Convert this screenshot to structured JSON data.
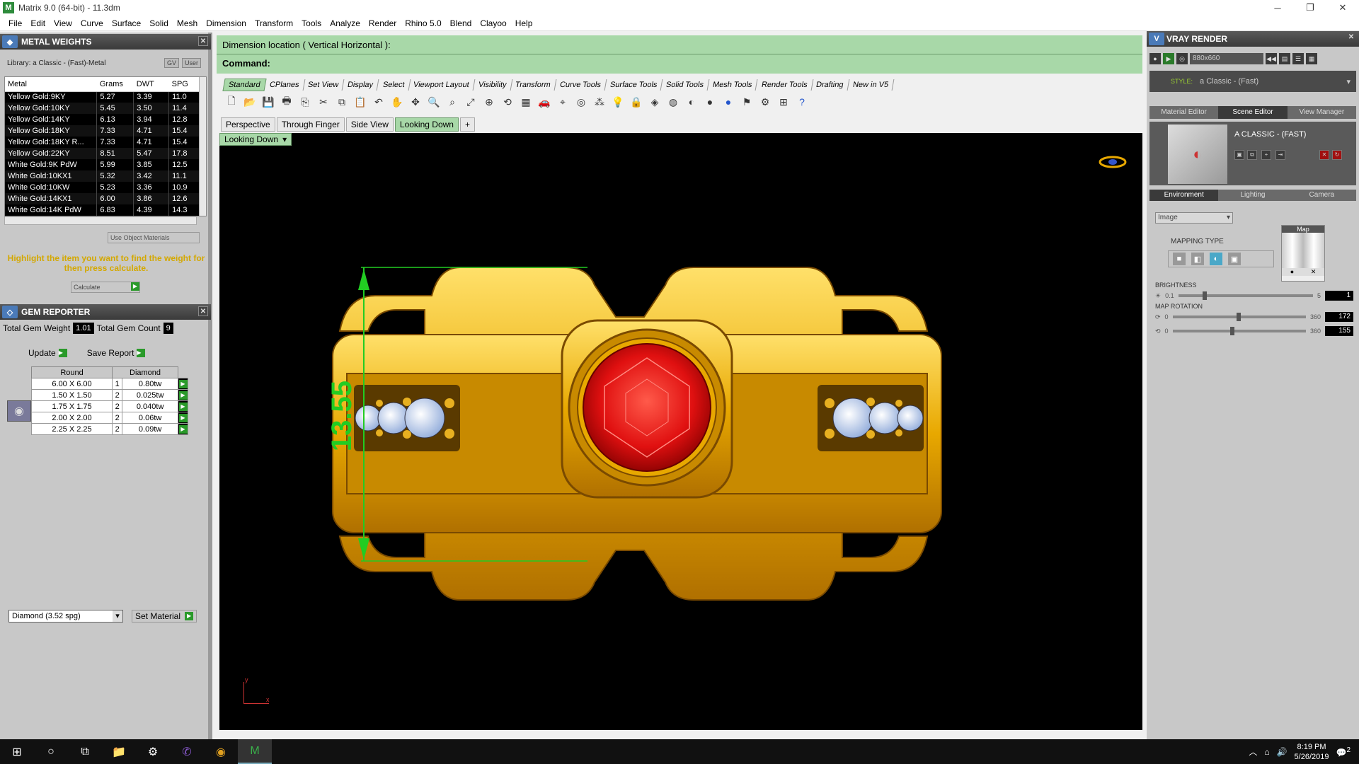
{
  "window": {
    "title": "Matrix 9.0 (64-bit) - 11.3dm",
    "logo": "M"
  },
  "menu": [
    "File",
    "Edit",
    "View",
    "Curve",
    "Surface",
    "Solid",
    "Mesh",
    "Dimension",
    "Transform",
    "Tools",
    "Analyze",
    "Render",
    "Rhino 5.0",
    "Blend",
    "Clayoo",
    "Help"
  ],
  "metal_weights": {
    "title": "METAL WEIGHTS",
    "library": "Library: a Classic - (Fast)-Metal",
    "lib_btns": [
      "GV",
      "User"
    ],
    "columns": [
      "Metal",
      "Grams",
      "DWT",
      "SPG"
    ],
    "rows": [
      [
        "Yellow Gold:9KY",
        "5.27",
        "3.39",
        "11.0"
      ],
      [
        "Yellow Gold:10KY",
        "5.45",
        "3.50",
        "11.4"
      ],
      [
        "Yellow Gold:14KY",
        "6.13",
        "3.94",
        "12.8"
      ],
      [
        "Yellow Gold:18KY",
        "7.33",
        "4.71",
        "15.4"
      ],
      [
        "Yellow Gold:18KY R...",
        "7.33",
        "4.71",
        "15.4"
      ],
      [
        "Yellow Gold:22KY",
        "8.51",
        "5.47",
        "17.8"
      ],
      [
        "White Gold:9K PdW",
        "5.99",
        "3.85",
        "12.5"
      ],
      [
        "White Gold:10KX1",
        "5.32",
        "3.42",
        "11.1"
      ],
      [
        "White Gold:10KW",
        "5.23",
        "3.36",
        "10.9"
      ],
      [
        "White Gold:14KX1",
        "6.00",
        "3.86",
        "12.6"
      ],
      [
        "White Gold:14K PdW",
        "6.83",
        "4.39",
        "14.3"
      ]
    ],
    "use_object": "Use Object Materials",
    "hint": "Highlight the item you want to find the weight for then press calculate.",
    "calculate": "Calculate"
  },
  "gem_reporter": {
    "title": "GEM REPORTER",
    "total_weight_label": "Total Gem Weight",
    "total_weight": "1.01",
    "total_count_label": "Total Gem Count",
    "total_count": "9",
    "update": "Update",
    "save_report": "Save Report",
    "col1": "Round",
    "col2": "Diamond",
    "rows": [
      [
        "6.00 X 6.00",
        "1",
        "0.80tw"
      ],
      [
        "1.50 X 1.50",
        "2",
        "0.025tw"
      ],
      [
        "1.75 X 1.75",
        "2",
        "0.040tw"
      ],
      [
        "2.00 X 2.00",
        "2",
        "0.06tw"
      ],
      [
        "2.25 X 2.25",
        "2",
        "0.09tw"
      ]
    ],
    "material": "Diamond    (3.52 spg)",
    "set_material": "Set Material"
  },
  "command": {
    "prompt": "Dimension location ( Vertical  Horizontal ):",
    "label": "Command:"
  },
  "tabs": [
    "Standard",
    "CPlanes",
    "Set View",
    "Display",
    "Select",
    "Viewport Layout",
    "Visibility",
    "Transform",
    "Curve Tools",
    "Surface Tools",
    "Solid Tools",
    "Mesh Tools",
    "Render Tools",
    "Drafting",
    "New in V5"
  ],
  "view_tabs": [
    "Perspective",
    "Through Finger",
    "Side View",
    "Looking Down"
  ],
  "viewport": {
    "name": "Looking Down",
    "dimension": "13.55",
    "axis_x": "x",
    "axis_y": "y"
  },
  "vray": {
    "title": "VRAY RENDER",
    "resolution": "880x660",
    "style_label": "STYLE:",
    "style_value": "a Classic - (Fast)",
    "editor_tabs": [
      "Material Editor",
      "Scene Editor",
      "View Manager"
    ],
    "scene_title": "A CLASSIC - (FAST)",
    "env_tabs": [
      "Environment",
      "Lighting",
      "Camera"
    ],
    "image_select": "Image",
    "map_label": "Map",
    "mapping_type": "MAPPING TYPE",
    "brightness_label": "BRIGHTNESS",
    "brightness_min": "0.1",
    "brightness_max": "5",
    "brightness_val": "1",
    "brightness_level": 0.18,
    "map_rotation_label": "MAP ROTATION",
    "rot_min": "0",
    "rot_max": "360",
    "rot1_val": "172",
    "rot2_val": "155",
    "rot1_level": 0.478,
    "rot2_level": 0.431
  },
  "taskbar": {
    "time": "8:19 PM",
    "date": "5/26/2019",
    "notif": "2"
  },
  "colors": {
    "accent_green": "#a8d8a8",
    "dim_green": "#22cc22",
    "gold": "#d4a800",
    "ruby": "#e01010"
  }
}
